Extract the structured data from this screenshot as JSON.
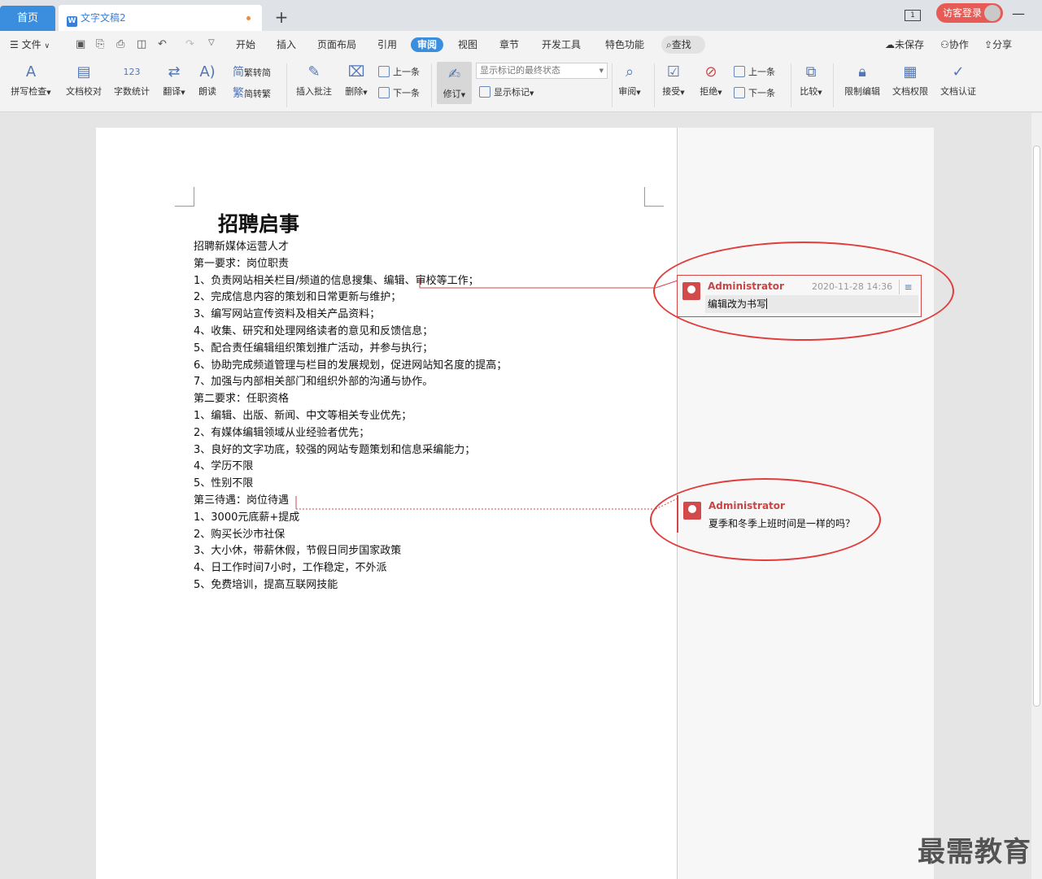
{
  "tabs": {
    "home": "首页",
    "doc": "文字文稿2"
  },
  "login": "访客登录",
  "menu": {
    "file": "文件",
    "items": [
      "开始",
      "插入",
      "页面布局",
      "引用",
      "审阅",
      "视图",
      "章节",
      "开发工具",
      "特色功能"
    ],
    "search": "查找",
    "unsaved": "未保存",
    "collab": "协作",
    "share": "分享"
  },
  "ribbon": {
    "spell": "拼写检查",
    "proof": "文档校对",
    "wordcount": "字数统计",
    "translate": "翻译",
    "read": "朗读",
    "trad": "繁转简",
    "simp": "简转繁",
    "insert_comment": "插入批注",
    "delete": "删除",
    "prev1": "上一条",
    "next1": "下一条",
    "revise": "修订",
    "mark_state": "显示标记的最终状态",
    "show_marks": "显示标记",
    "review": "审阅",
    "accept": "接受",
    "reject": "拒绝",
    "prev2": "上一条",
    "next2": "下一条",
    "compare": "比较",
    "restrict": "限制编辑",
    "perm": "文档权限",
    "cert": "文档认证"
  },
  "document": {
    "title": "招聘启事",
    "lines": [
      "招聘新媒体运营人才",
      "第一要求：岗位职责",
      "1、负责网站相关栏目/频道的信息搜集、编辑、审校等工作；",
      "2、完成信息内容的策划和日常更新与维护；",
      "3、编写网站宣传资料及相关产品资料；",
      "4、收集、研究和处理网络读者的意见和反馈信息；",
      "5、配合责任编辑组织策划推广活动，并参与执行；",
      "6、协助完成频道管理与栏目的发展规划，促进网站知名度的提高；",
      "7、加强与内部相关部门和组织外部的沟通与协作。",
      "第二要求：任职资格",
      "1、编辑、出版、新闻、中文等相关专业优先；",
      "2、有媒体编辑领域从业经验者优先；",
      "3、良好的文字功底，较强的网站专题策划和信息采编能力；",
      "4、学历不限",
      "5、性别不限",
      "第三待遇：岗位待遇",
      "1、3000元底薪+提成",
      "2、购买长沙市社保",
      "3、大小休，带薪休假，节假日同步国家政策",
      "4、日工作时间7小时，工作稳定，不外派",
      "5、免费培训，提高互联网技能"
    ]
  },
  "comments": [
    {
      "author": "Administrator",
      "time": "2020-11-28 14:36",
      "text": "编辑改为书写"
    },
    {
      "author": "Administrator",
      "text": "夏季和冬季上班时间是一样的吗？"
    }
  ],
  "watermark": "最需教育",
  "colors": {
    "accent": "#3b8ede",
    "comment_author": "#c94545",
    "annotation": "#e03d3d"
  }
}
